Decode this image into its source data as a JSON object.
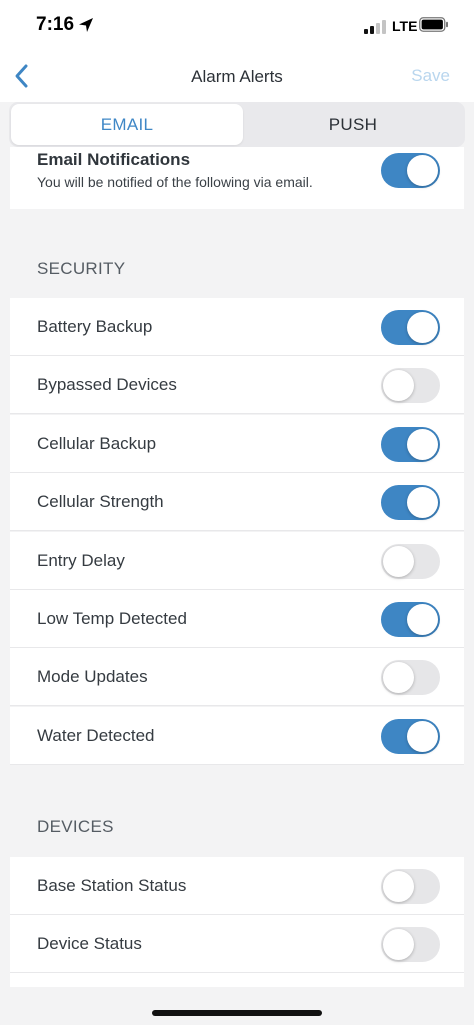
{
  "status_bar": {
    "time": "7:16",
    "network": "LTE"
  },
  "nav": {
    "title": "Alarm Alerts",
    "save_label": "Save"
  },
  "tabs": [
    {
      "label": "EMAIL",
      "selected": true
    },
    {
      "label": "PUSH",
      "selected": false
    }
  ],
  "email_notifications": {
    "title": "Email Notifications",
    "subtitle": "You will be notified of the following via email.",
    "enabled": true
  },
  "sections": [
    {
      "header": "SECURITY",
      "items": [
        {
          "label": "Battery Backup",
          "enabled": true
        },
        {
          "label": "Bypassed Devices",
          "enabled": false
        },
        {
          "label": "Cellular Backup",
          "enabled": true
        },
        {
          "label": "Cellular Strength",
          "enabled": true
        },
        {
          "label": "Entry Delay",
          "enabled": false
        },
        {
          "label": "Low Temp Detected",
          "enabled": true
        },
        {
          "label": "Mode Updates",
          "enabled": false
        },
        {
          "label": "Water Detected",
          "enabled": true
        }
      ]
    },
    {
      "header": "DEVICES",
      "items": [
        {
          "label": "Base Station Status",
          "enabled": false
        },
        {
          "label": "Device Status",
          "enabled": false
        }
      ]
    }
  ],
  "colors": {
    "accent": "#3e86c4",
    "toggle_off": "#e6e6e8",
    "save_disabled": "#b9d6ee"
  }
}
